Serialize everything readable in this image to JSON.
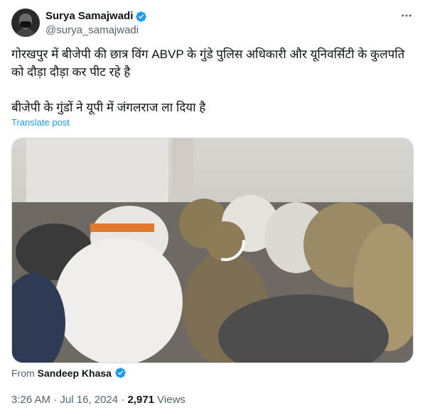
{
  "author": {
    "display_name": "Surya Samajwadi",
    "handle": "@surya_samajwadi"
  },
  "tweet": {
    "text": "गोरखपुर में बीजेपी की छात्र विंग ABVP के गुंडे पुलिस अधिकारी और यूनिवर्सिटी के कुलपति को दौड़ा दौड़ा कर पीट रहे है\n\nबीजेपी के गुंडों ने यूपी में जंगलराज ला दिया है",
    "translate_label": "Translate post"
  },
  "media": {
    "type": "video",
    "state": "loading"
  },
  "source": {
    "from_label": "From",
    "from_name": "Sandeep Khasa"
  },
  "meta": {
    "time": "3:26 AM",
    "separator1": " · ",
    "date": "Jul 16, 2024",
    "separator2": " · ",
    "views_count": "2,971",
    "views_label": " Views"
  },
  "colors": {
    "accent": "#1d9bf0",
    "text": "#0f1419",
    "secondary": "#536471"
  },
  "icons": [
    "verified-badge-icon",
    "more-options-icon",
    "loading-spinner-icon"
  ]
}
